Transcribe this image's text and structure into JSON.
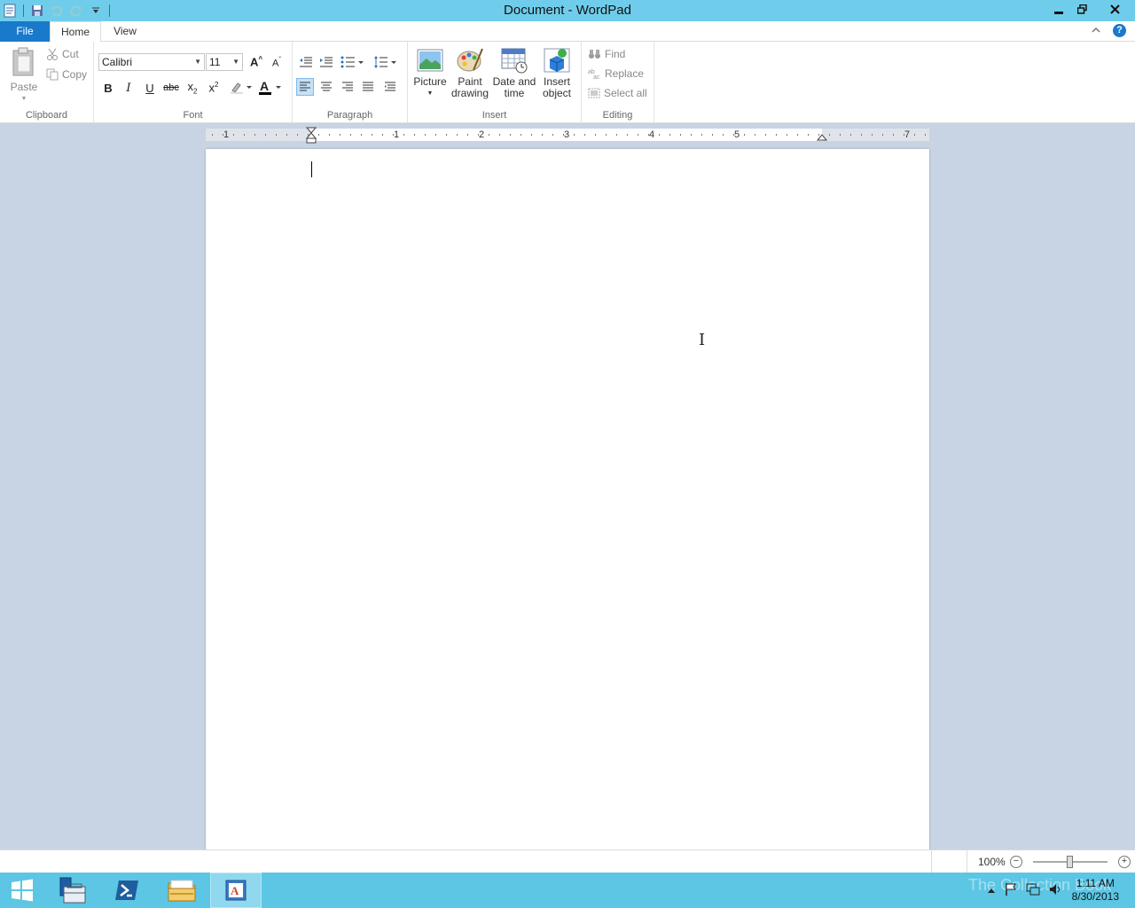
{
  "window": {
    "title": "Document - WordPad"
  },
  "tabs": {
    "file": "File",
    "home": "Home",
    "view": "View"
  },
  "clipboard": {
    "label": "Clipboard",
    "paste": "Paste",
    "cut": "Cut",
    "copy": "Copy"
  },
  "font": {
    "label": "Font",
    "family": "Calibri",
    "size": "11"
  },
  "paragraph": {
    "label": "Paragraph"
  },
  "insert": {
    "label": "Insert",
    "picture": "Picture",
    "paint_line1": "Paint",
    "paint_line2": "drawing",
    "datetime_line1": "Date and",
    "datetime_line2": "time",
    "object_line1": "Insert",
    "object_line2": "object"
  },
  "editing": {
    "label": "Editing",
    "find": "Find",
    "replace": "Replace",
    "select_all": "Select all"
  },
  "ruler": {
    "numbers": [
      "1",
      "1",
      "2",
      "3",
      "4",
      "5",
      "7"
    ]
  },
  "status": {
    "zoom": "100%"
  },
  "taskbar": {
    "time": "1:11 AM",
    "date": "8/30/2013",
    "watermark": "The Collection Book"
  },
  "colors": {
    "titlebar": "#6fcdeb",
    "file_tab": "#1979ca",
    "taskbar": "#5cc6e4",
    "workspace": "#c8d4e3"
  }
}
